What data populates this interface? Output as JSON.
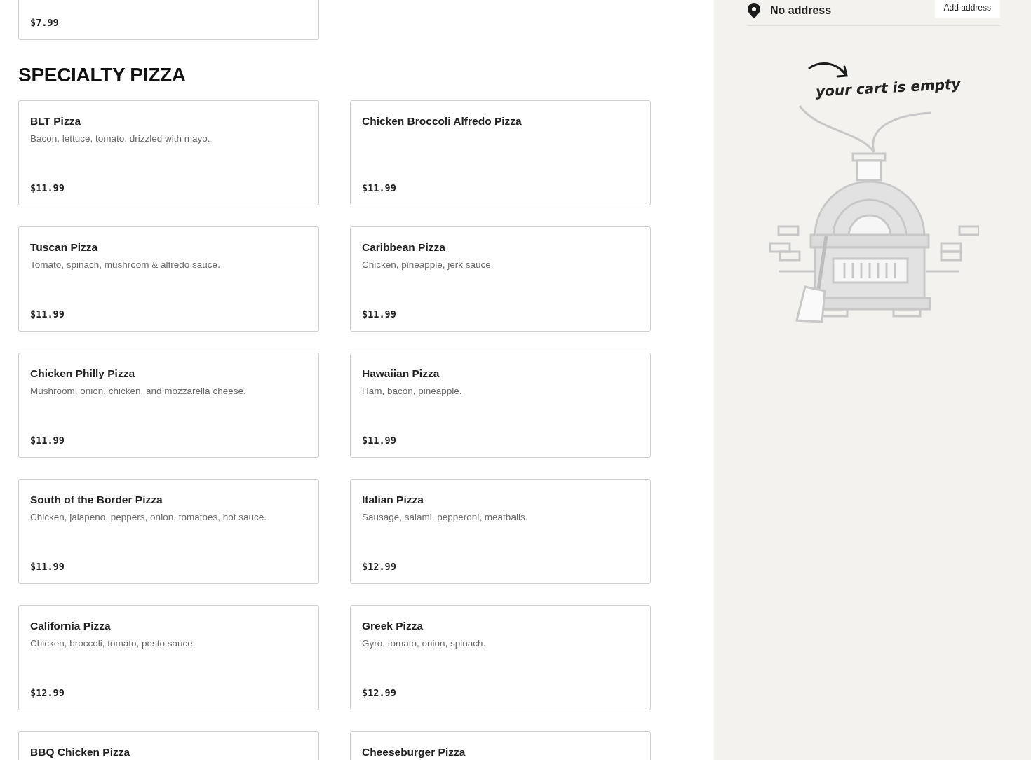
{
  "previous_item": {
    "price": "$7.99"
  },
  "section": {
    "title": "SPECIALTY PIZZA",
    "items": [
      {
        "name": "BLT Pizza",
        "description": "Bacon, lettuce, tomato, drizzled with mayo.",
        "price": "$11.99"
      },
      {
        "name": "Chicken Broccoli Alfredo Pizza",
        "price": "$11.99"
      },
      {
        "name": "Tuscan Pizza",
        "description": "Tomato, spinach, mushroom & alfredo sauce.",
        "price": "$11.99"
      },
      {
        "name": "Caribbean Pizza",
        "description": "Chicken, pineapple, jerk sauce.",
        "price": "$11.99"
      },
      {
        "name": "Chicken Philly Pizza",
        "description": "Mushroom, onion, chicken, and mozzarella cheese.",
        "price": "$11.99"
      },
      {
        "name": "Hawaiian Pizza",
        "description": "Ham, bacon, pineapple.",
        "price": "$11.99"
      },
      {
        "name": "South of the Border Pizza",
        "description": "Chicken, jalapeno, peppers, onion, tomatoes, hot sauce.",
        "price": "$11.99"
      },
      {
        "name": "Italian Pizza",
        "description": "Sausage, salami, pepperoni, meatballs.",
        "price": "$12.99"
      },
      {
        "name": "California Pizza",
        "description": "Chicken, broccoli, tomato, pesto sauce.",
        "price": "$12.99"
      },
      {
        "name": "Greek Pizza",
        "description": "Gyro, tomato, onion, spinach.",
        "price": "$12.99"
      },
      {
        "name": "BBQ Chicken Pizza"
      },
      {
        "name": "Cheeseburger Pizza"
      }
    ]
  },
  "cart": {
    "address": "No address",
    "address_button": "Add address",
    "empty_message": "your cart is empty"
  }
}
